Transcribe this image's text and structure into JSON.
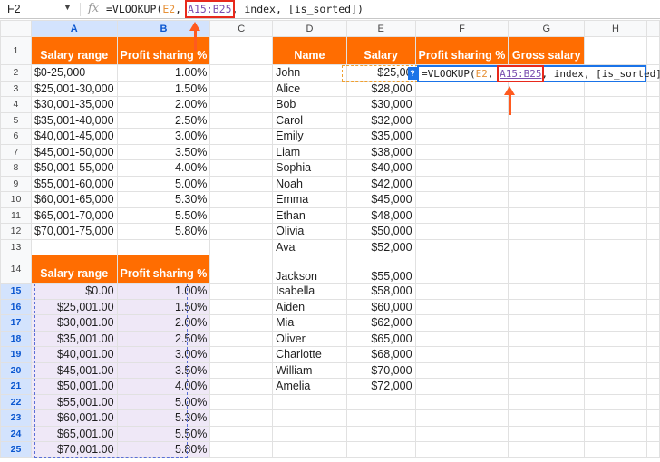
{
  "formula_bar": {
    "cell_ref": "F2",
    "fx": "fx",
    "formula_prefix": "=VLOOKUP(",
    "formula_e2": "E2",
    "formula_sep": ", ",
    "formula_range": "A15:B25",
    "formula_suffix": ", index, [is_sorted])"
  },
  "columns": [
    "A",
    "B",
    "C",
    "D",
    "E",
    "F",
    "G",
    "H"
  ],
  "headers": {
    "salary_range": "Salary range",
    "profit_sharing": "Profit sharing %",
    "name": "Name",
    "salary": "Salary",
    "gross_salary": "Gross salary"
  },
  "ranges": [
    "$0-25,000",
    "$25,001-30,000",
    "$30,001-35,000",
    "$35,001-40,000",
    "$40,001-45,000",
    "$45,001-50,000",
    "$50,001-55,000",
    "$55,001-60,000",
    "$60,001-65,000",
    "$65,001-70,000",
    "$70,001-75,000"
  ],
  "percents": [
    "1.00%",
    "1.50%",
    "2.00%",
    "2.50%",
    "3.00%",
    "3.50%",
    "4.00%",
    "5.00%",
    "5.30%",
    "5.50%",
    "5.80%"
  ],
  "lookup_mins": [
    "$0.00",
    "$25,001.00",
    "$30,001.00",
    "$35,001.00",
    "$40,001.00",
    "$45,001.00",
    "$50,001.00",
    "$55,001.00",
    "$60,001.00",
    "$65,001.00",
    "$70,001.00"
  ],
  "employees": [
    {
      "name": "John",
      "salary": "$25,00"
    },
    {
      "name": "Alice",
      "salary": "$28,000"
    },
    {
      "name": "Bob",
      "salary": "$30,000"
    },
    {
      "name": "Carol",
      "salary": "$32,000"
    },
    {
      "name": "Emily",
      "salary": "$35,000"
    },
    {
      "name": "Liam",
      "salary": "$38,000"
    },
    {
      "name": "Sophia",
      "salary": "$40,000"
    },
    {
      "name": "Noah",
      "salary": "$42,000"
    },
    {
      "name": "Emma",
      "salary": "$45,000"
    },
    {
      "name": "Ethan",
      "salary": "$48,000"
    },
    {
      "name": "Olivia",
      "salary": "$50,000"
    },
    {
      "name": "Ava",
      "salary": "$52,000"
    },
    {
      "name": "Jackson",
      "salary": "$55,000"
    },
    {
      "name": "Isabella",
      "salary": "$58,000"
    },
    {
      "name": "Aiden",
      "salary": "$60,000"
    },
    {
      "name": "Mia",
      "salary": "$62,000"
    },
    {
      "name": "Oliver",
      "salary": "$65,000"
    },
    {
      "name": "Charlotte",
      "salary": "$68,000"
    },
    {
      "name": "William",
      "salary": "$70,000"
    },
    {
      "name": "Amelia",
      "salary": "$72,000"
    }
  ],
  "formula_help": "?",
  "colors": {
    "header_orange": "#ff6d01",
    "selection_blue": "#1a73e8",
    "range_lavender": "#efe8f7",
    "arrow": "#ff5a1f"
  }
}
